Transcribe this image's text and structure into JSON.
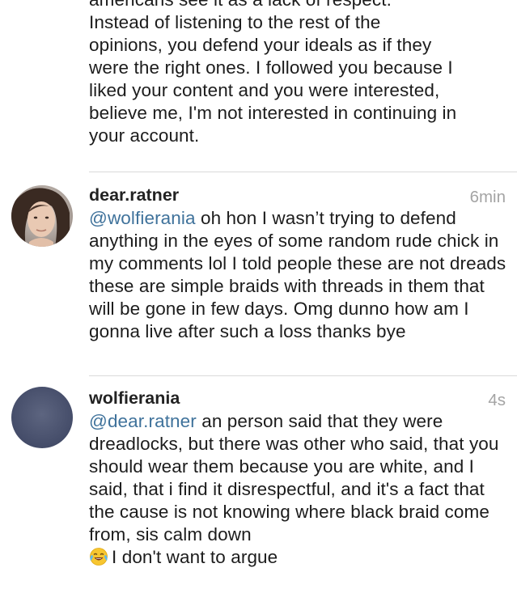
{
  "top_comment": {
    "lines": [
      "americans see it as a lack of respect.",
      "Instead of listening to the rest of the",
      "opinions, you defend your ideals as if they",
      "were the right ones.  I followed you because I",
      "liked your content and you were interested,",
      "believe me, I'm not interested in continuing in",
      "your account."
    ]
  },
  "comments": [
    {
      "username": "dear.ratner",
      "time": "6min",
      "mention": "@wolfierania",
      "text": " oh hon I wasn’t trying to defend anything in the eyes of some random rude chick in my comments lol I told people these are not dreads these are simple braids with threads in them that will be gone in few days. Omg dunno how am I gonna live after such a loss thanks bye",
      "avatar_icon": "user-photo-avatar"
    },
    {
      "username": "wolfierania",
      "time": "4s",
      "mention": "@dear.ratner",
      "text_before_emoji": " an person said that they were dreadlocks, but there was other who said, that you should wear them because you are white, and I said, that i find it disrespectful, and it's a fact that the cause is not knowing where black braid come from, sis calm down",
      "emoji_icon": "face-with-tears-of-joy-emoji",
      "text_after_emoji": "I don't want to argue",
      "avatar_icon": "moon-night-sky-avatar"
    }
  ],
  "colors": {
    "mention": "#3f729b",
    "timestamp": "#a4a4a4",
    "divider": "#d9d9d9"
  }
}
